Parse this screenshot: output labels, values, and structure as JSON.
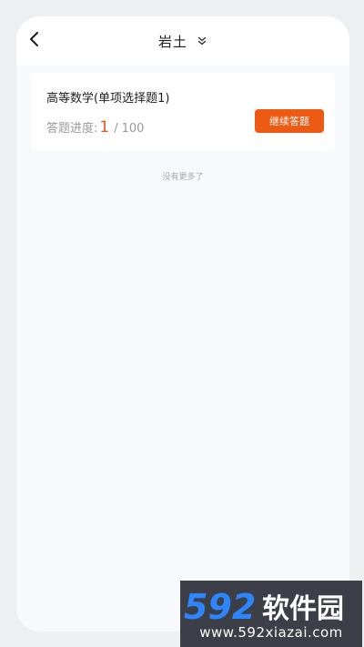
{
  "header": {
    "back_icon": "chevron-left-icon",
    "title": "岩土",
    "dropdown_icon": "double-chevron-down-icon"
  },
  "card": {
    "title": "高等数学(单项选择题1)",
    "progress_label": "答题进度:",
    "progress_current": "1",
    "progress_separator": "/",
    "progress_total": "100",
    "continue_button": "继续答题"
  },
  "list_end_text": "没有更多了",
  "watermark": {
    "logo_text": "592软件园",
    "url": "www.592xiazai.com"
  },
  "colors": {
    "accent": "#ed5a13",
    "progress_number": "#e7541a",
    "watermark_digits": "#2e86ff"
  }
}
